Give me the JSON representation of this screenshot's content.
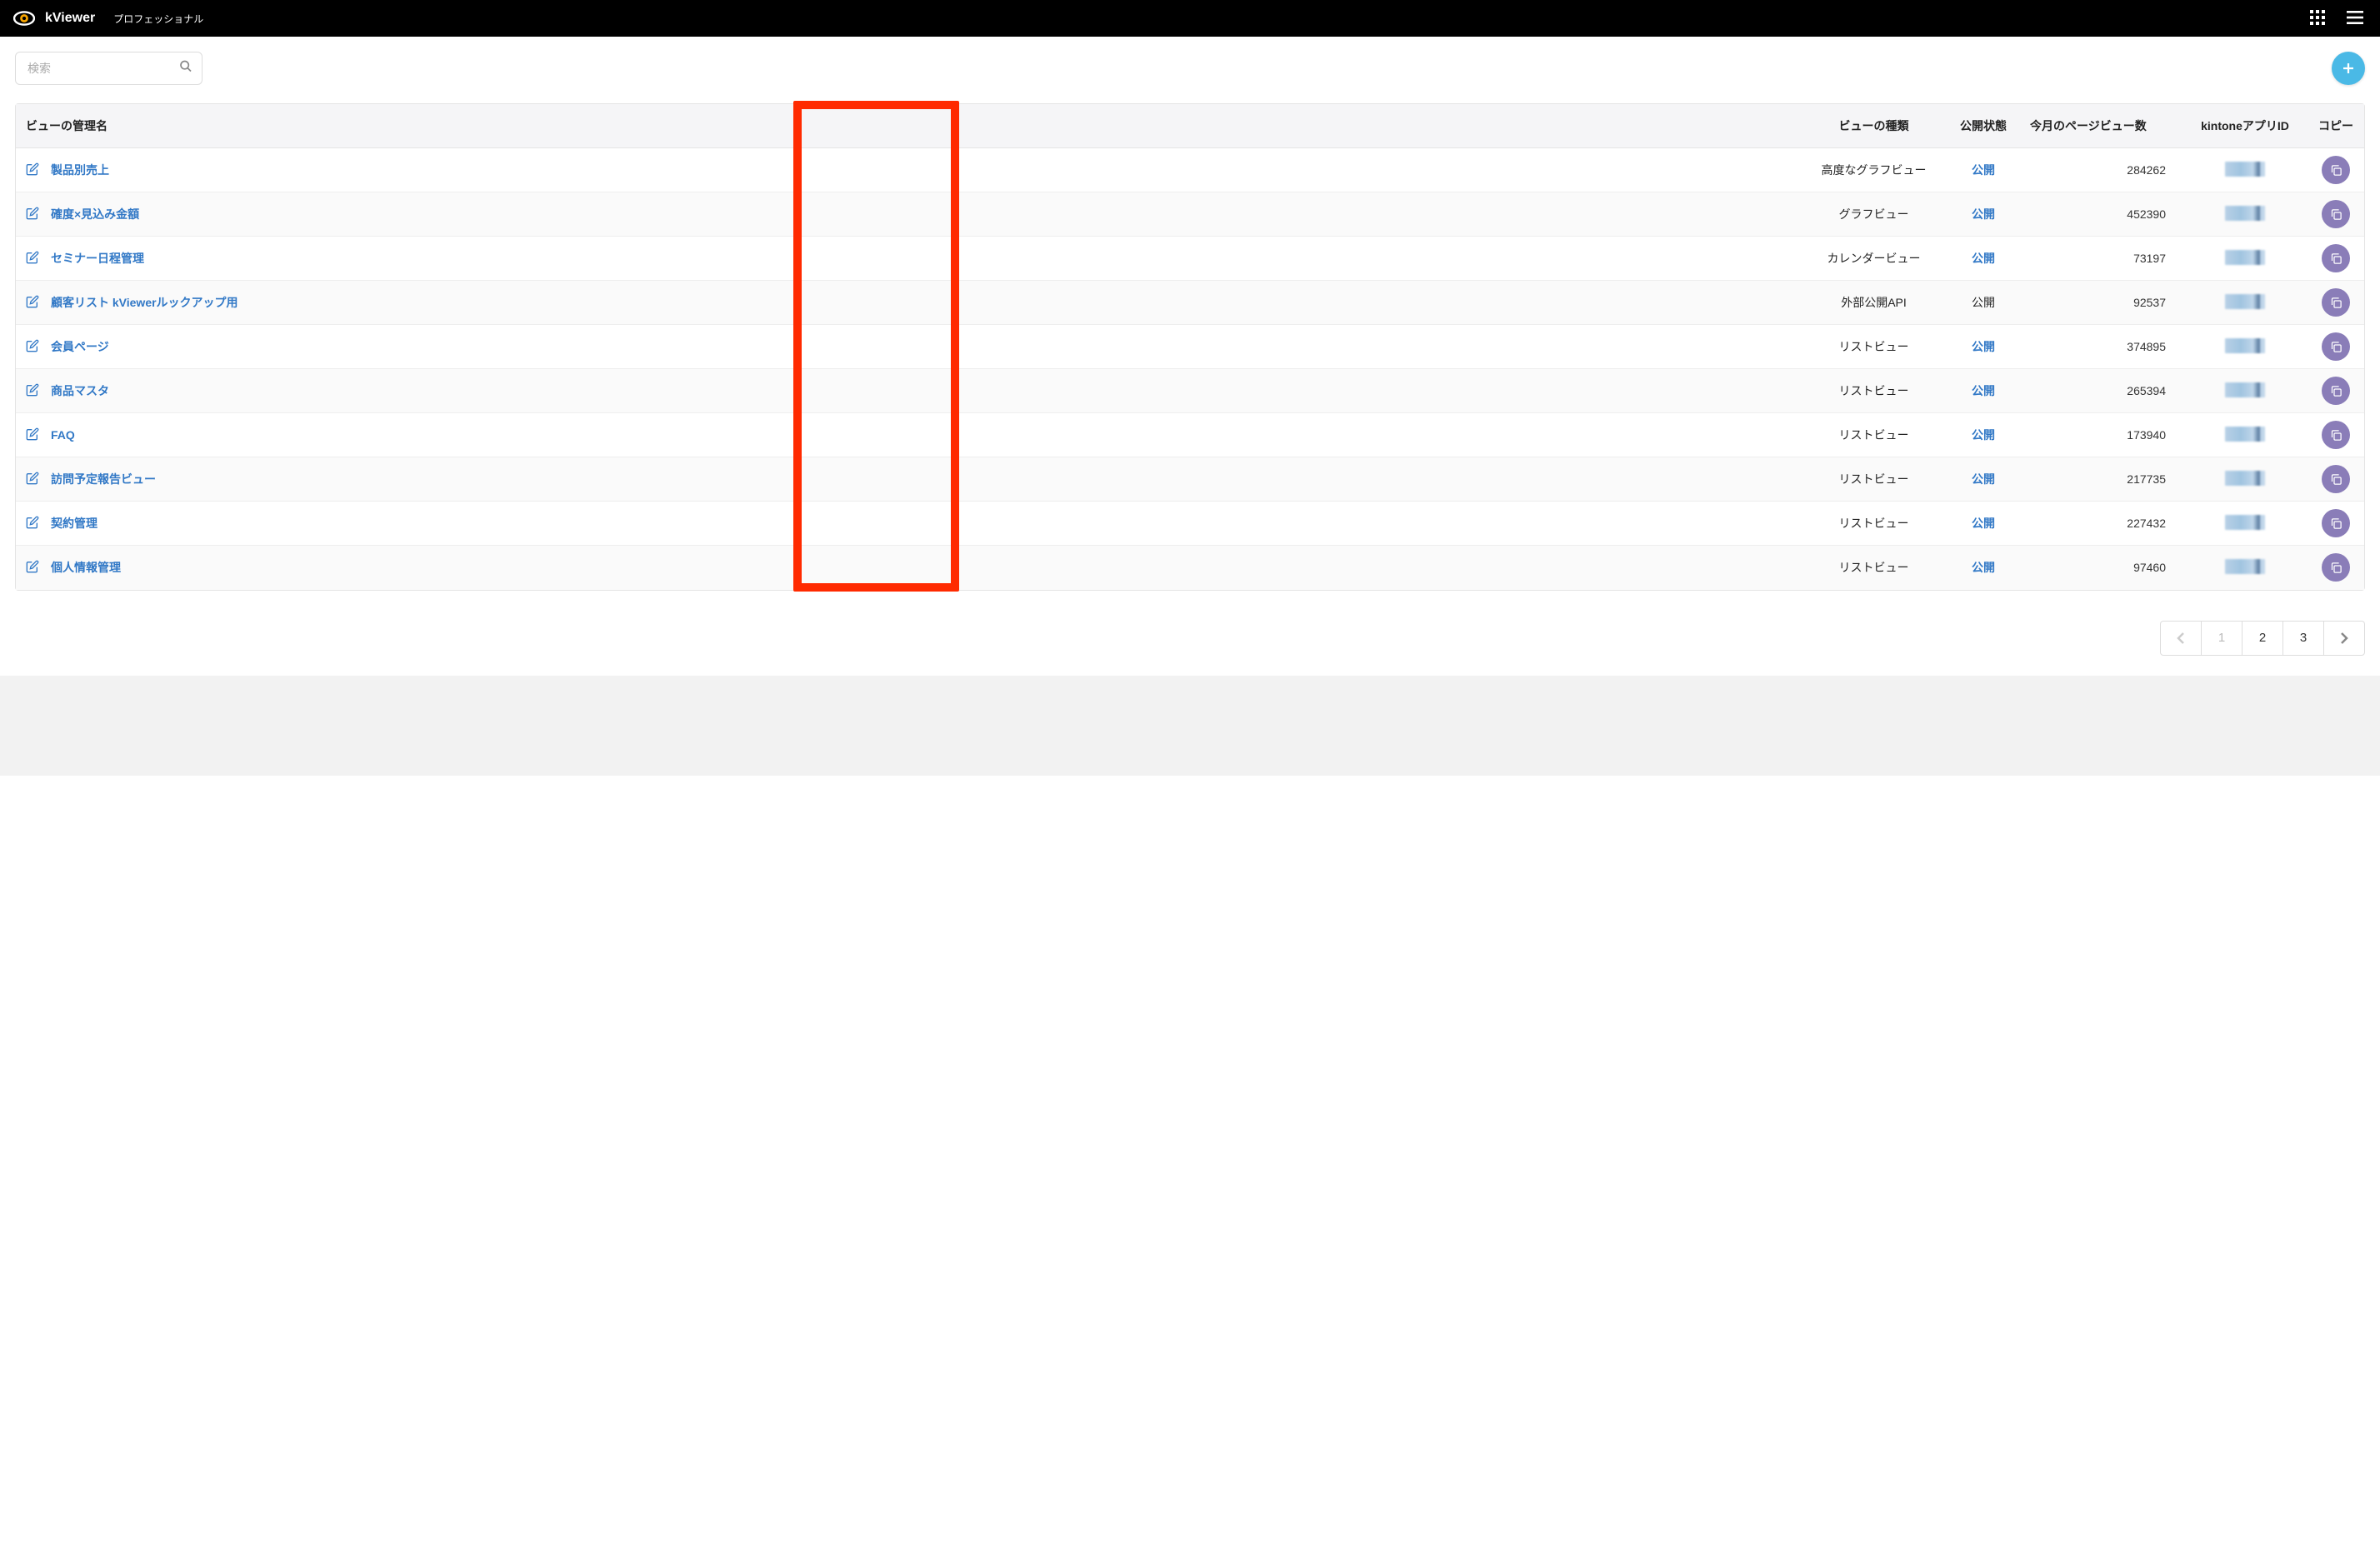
{
  "header": {
    "app_name": "kViewer",
    "plan": "プロフェッショナル"
  },
  "search": {
    "placeholder": "検索"
  },
  "table": {
    "columns": {
      "name": "ビューの管理名",
      "type": "ビューの種類",
      "state": "公開状態",
      "pageviews": "今月のページビュー数",
      "appid": "kintoneアプリID",
      "copy": "コピー"
    },
    "rows": [
      {
        "name": "製品別売上",
        "type": "高度なグラフビュー",
        "state": "公開",
        "state_link": true,
        "pv": "284262"
      },
      {
        "name": "確度×見込み金額",
        "type": "グラフビュー",
        "state": "公開",
        "state_link": true,
        "pv": "452390"
      },
      {
        "name": "セミナー日程管理",
        "type": "カレンダービュー",
        "state": "公開",
        "state_link": true,
        "pv": "73197"
      },
      {
        "name": "顧客リスト kViewerルックアップ用",
        "type": "外部公開API",
        "state": "公開",
        "state_link": false,
        "pv": "92537"
      },
      {
        "name": "会員ページ",
        "type": "リストビュー",
        "state": "公開",
        "state_link": true,
        "pv": "374895"
      },
      {
        "name": "商品マスタ",
        "type": "リストビュー",
        "state": "公開",
        "state_link": true,
        "pv": "265394"
      },
      {
        "name": "FAQ",
        "type": "リストビュー",
        "state": "公開",
        "state_link": true,
        "pv": "173940"
      },
      {
        "name": "訪問予定報告ビュー",
        "type": "リストビュー",
        "state": "公開",
        "state_link": true,
        "pv": "217735"
      },
      {
        "name": "契約管理",
        "type": "リストビュー",
        "state": "公開",
        "state_link": true,
        "pv": "227432"
      },
      {
        "name": "個人情報管理",
        "type": "リストビュー",
        "state": "公開",
        "state_link": true,
        "pv": "97460"
      }
    ]
  },
  "pagination": {
    "pages": [
      "1",
      "2",
      "3"
    ],
    "current": "1"
  }
}
